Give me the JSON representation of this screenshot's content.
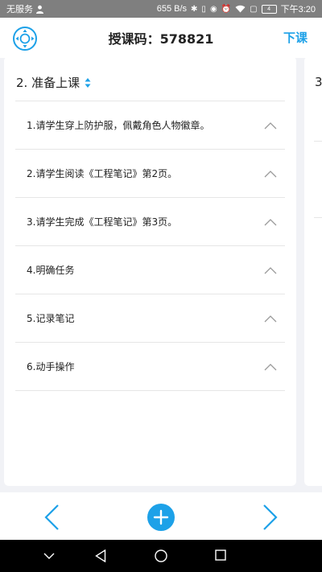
{
  "status_bar": {
    "carrier": "无服务",
    "speed": "655 B/s",
    "battery_level": "4",
    "time": "下午3:20"
  },
  "header": {
    "title": "授课码：578821",
    "end_button": "下课",
    "accent_color": "#1da1e8"
  },
  "card": {
    "section_title": "2. 准备上课",
    "items": [
      {
        "label": "1.请学生穿上防护服，佩戴角色人物徽章。"
      },
      {
        "label": "2.请学生阅读《工程笔记》第2页。"
      },
      {
        "label": "3.请学生完成《工程笔记》第3页。"
      },
      {
        "label": "4.明确任务"
      },
      {
        "label": "5.记录笔记"
      },
      {
        "label": "6.动手操作"
      }
    ]
  },
  "next_card": {
    "section_title_partial": "3"
  },
  "bottom_bar": {
    "prev_icon": "chevron-left-icon",
    "add_icon": "plus-circle-icon",
    "next_icon": "chevron-right-icon"
  }
}
